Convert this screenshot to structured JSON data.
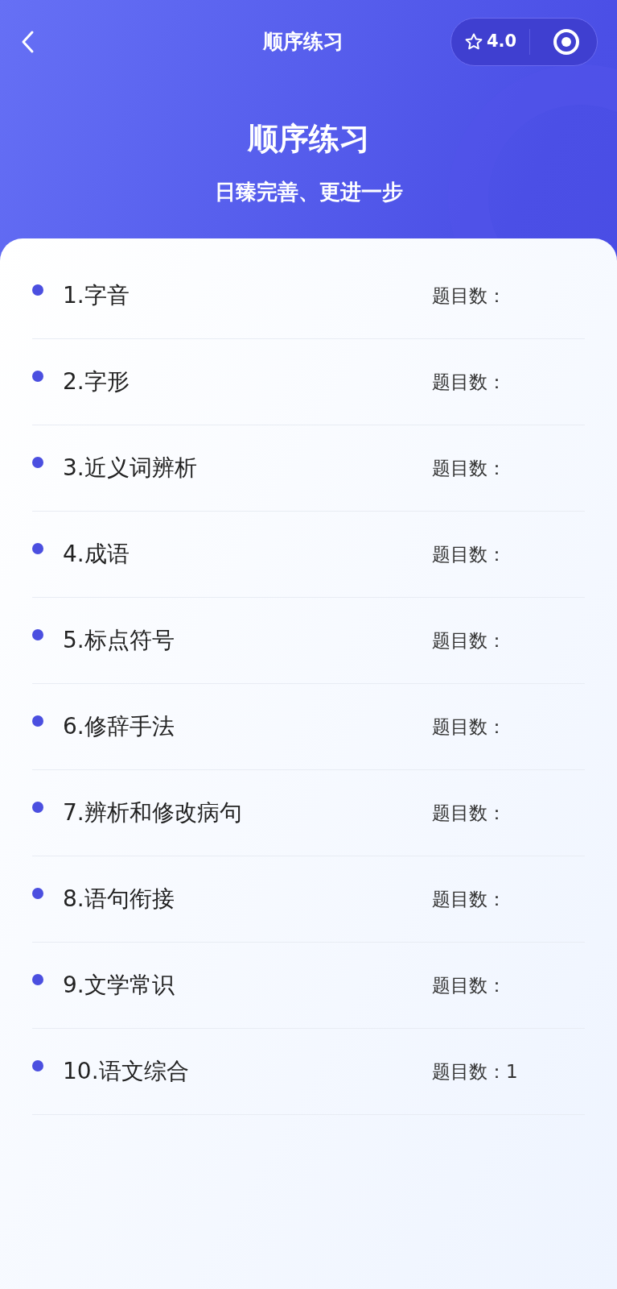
{
  "nav": {
    "title": "顺序练习",
    "rating": "4.0"
  },
  "hero": {
    "title": "顺序练习",
    "subtitle": "日臻完善、更进一步"
  },
  "items": [
    {
      "name": "1.字音",
      "count": "题目数："
    },
    {
      "name": "2.字形",
      "count": "题目数："
    },
    {
      "name": "3.近义词辨析",
      "count": "题目数："
    },
    {
      "name": "4.成语",
      "count": "题目数："
    },
    {
      "name": "5.标点符号",
      "count": "题目数："
    },
    {
      "name": "6.修辞手法",
      "count": "题目数："
    },
    {
      "name": "7.辨析和修改病句",
      "count": "题目数："
    },
    {
      "name": "8.语句衔接",
      "count": "题目数："
    },
    {
      "name": "9.文学常识",
      "count": "题目数："
    },
    {
      "name": "10.语文综合",
      "count": "题目数：1"
    }
  ]
}
